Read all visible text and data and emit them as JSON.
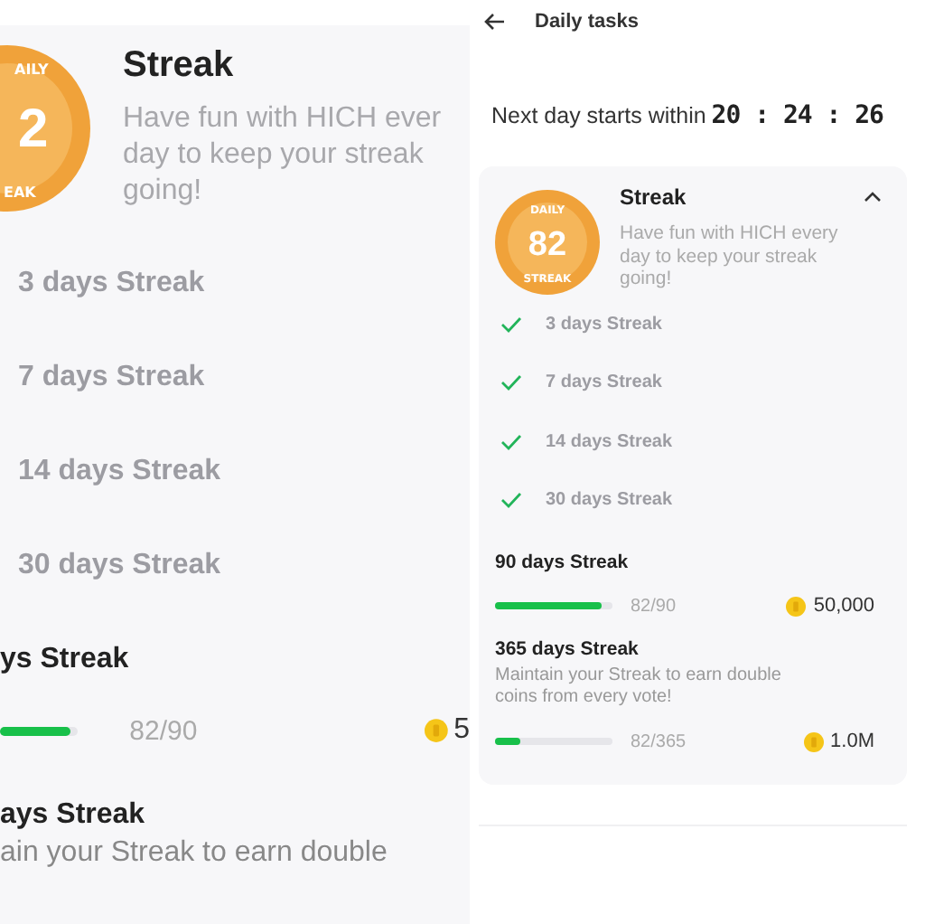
{
  "zoomed_view": {
    "badge": {
      "top": "AILY",
      "number": "2",
      "bottom": "EAK"
    },
    "title": "Streak",
    "description_lines": [
      "Have fun with HICH ever",
      "day to keep your streak",
      "going!"
    ],
    "milestones": [
      {
        "label": "3 days Streak",
        "completed": true
      },
      {
        "label": "7 days Streak",
        "completed": true
      },
      {
        "label": "14 days Streak",
        "completed": true
      },
      {
        "label": "30 days Streak",
        "completed": true
      }
    ],
    "current": {
      "title": "ys Streak",
      "level": 0.91,
      "progress": "82/90",
      "reward": "5"
    },
    "next": {
      "title": "ays Streak",
      "description": "ain your Streak to earn double"
    }
  },
  "screen": {
    "header": {
      "title": "Daily tasks"
    },
    "countdown": {
      "label": "Next day starts within",
      "time": "20 : 24 : 26"
    },
    "streak_card": {
      "badge": {
        "top": "DAILY",
        "number": "82",
        "bottom": "STREAK"
      },
      "title": "Streak",
      "expanded": true,
      "description": "Have fun with HICH every day to keep your streak going!",
      "milestones": [
        {
          "label": "3 days Streak",
          "completed": true
        },
        {
          "label": "7 days Streak",
          "completed": true
        },
        {
          "label": "14 days Streak",
          "completed": true
        },
        {
          "label": "30 days Streak",
          "completed": true
        }
      ],
      "goals": [
        {
          "title": "90 days Streak",
          "level": 0.91,
          "progress": "82/90",
          "reward": "50,000"
        },
        {
          "title": "365 days Streak",
          "description": "Maintain your Streak to earn double coins from every vote!",
          "level": 0.22,
          "progress": "82/365",
          "reward": "1.0M"
        }
      ]
    }
  }
}
